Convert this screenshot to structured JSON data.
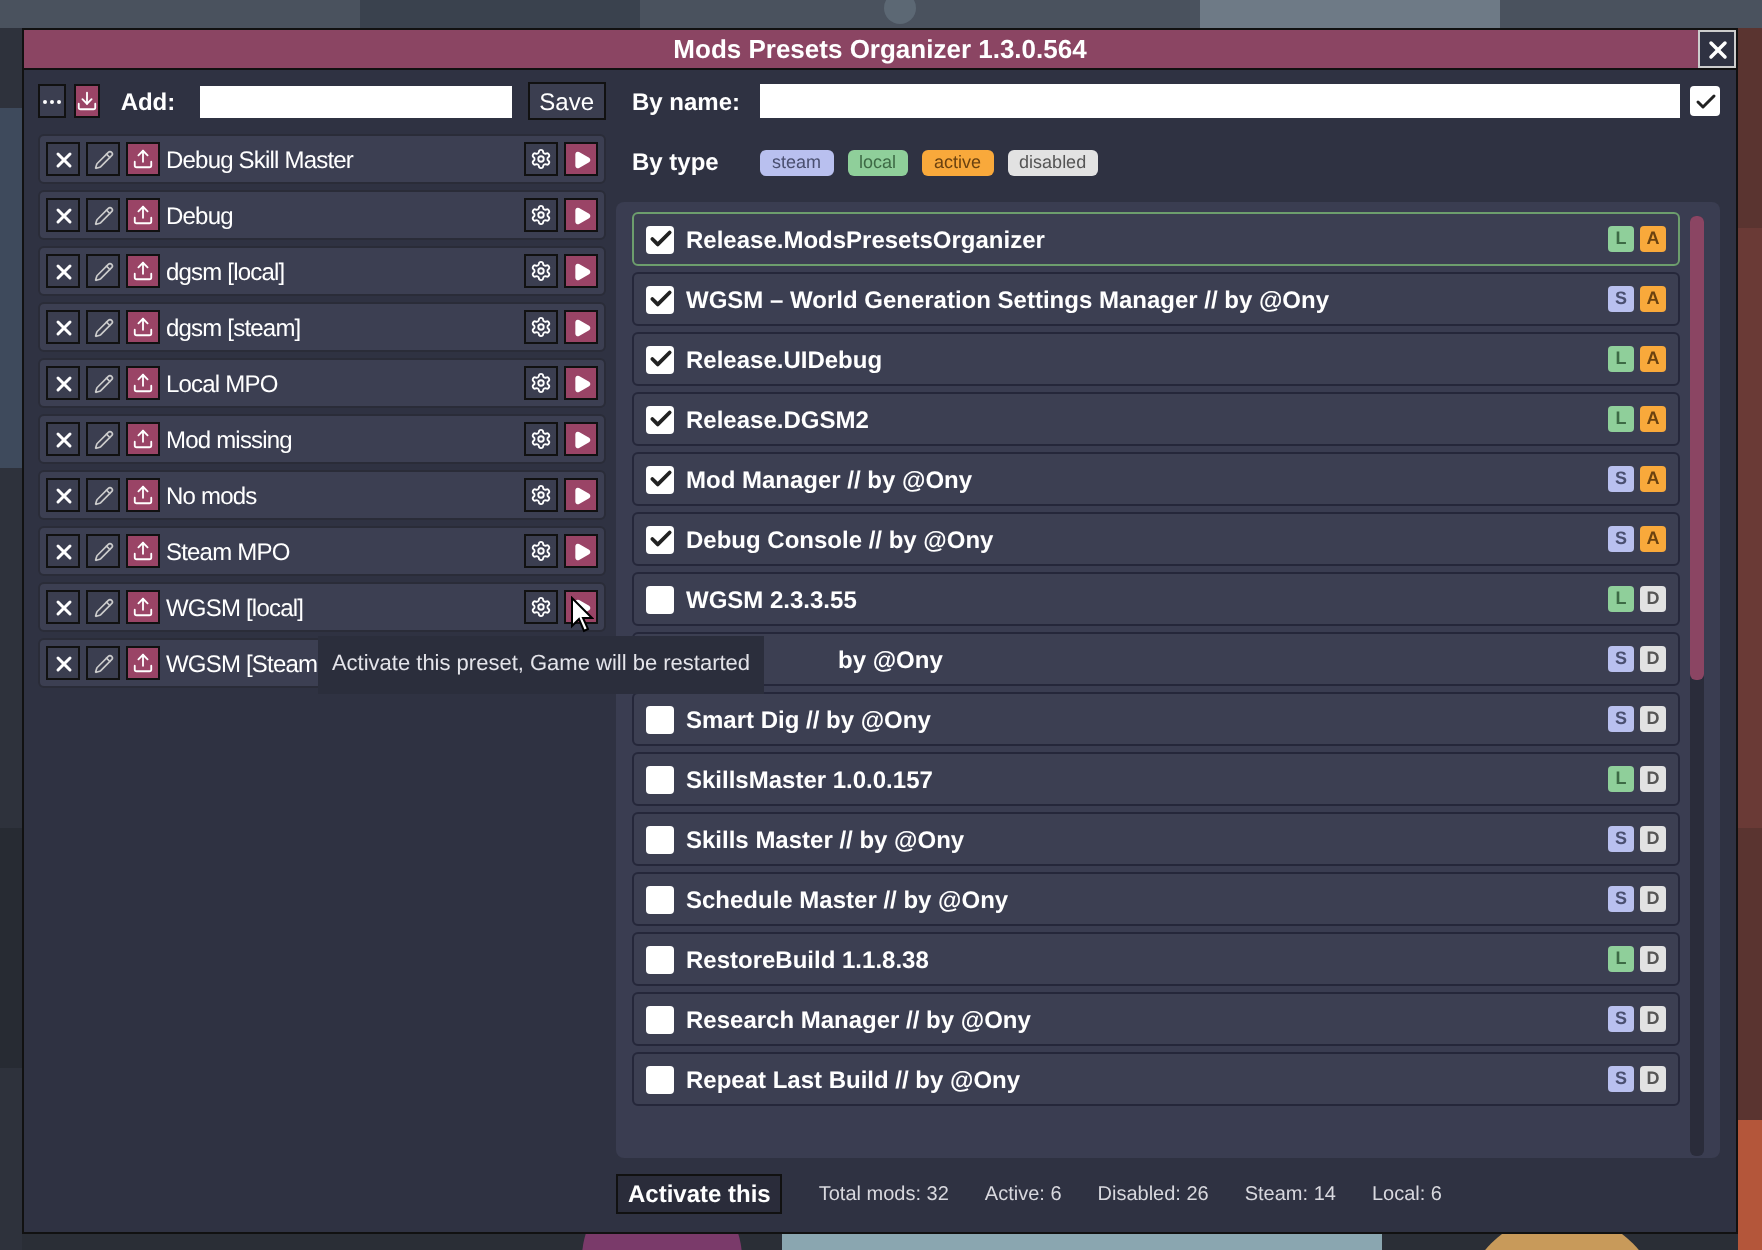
{
  "window": {
    "title": "Mods Presets Organizer 1.3.0.564"
  },
  "presets_toolbar": {
    "add_label": "Add:",
    "save_button": "Save"
  },
  "presets": [
    {
      "name": "Debug Skill Master",
      "covered": false
    },
    {
      "name": "Debug",
      "covered": false
    },
    {
      "name": "dgsm [local]",
      "covered": false
    },
    {
      "name": "dgsm [steam]",
      "covered": false
    },
    {
      "name": "Local MPO",
      "covered": false
    },
    {
      "name": "Mod missing",
      "covered": false
    },
    {
      "name": "No mods",
      "covered": false
    },
    {
      "name": "Steam MPO",
      "covered": false
    },
    {
      "name": "WGSM [local]",
      "covered": false
    },
    {
      "name": "WGSM [Steam",
      "covered": true
    }
  ],
  "tooltip": {
    "text": "Activate this preset, Game will be restarted"
  },
  "filters": {
    "by_name_label": "By name:",
    "by_name_checked": true,
    "by_type_label": "By type",
    "types": [
      {
        "label": "steam",
        "kind": "steam"
      },
      {
        "label": "local",
        "kind": "local"
      },
      {
        "label": "active",
        "kind": "active"
      },
      {
        "label": "disabled",
        "kind": "disabled"
      }
    ]
  },
  "mods": [
    {
      "name": "Release.ModsPresetsOrganizer",
      "checked": true,
      "selected": true,
      "covered": false,
      "badges": [
        {
          "text": "L",
          "kind": "local"
        },
        {
          "text": "A",
          "kind": "active"
        }
      ]
    },
    {
      "name": "WGSM – World Generation Settings Manager // by @Ony",
      "checked": true,
      "selected": false,
      "covered": false,
      "badges": [
        {
          "text": "S",
          "kind": "steam"
        },
        {
          "text": "A",
          "kind": "active"
        }
      ]
    },
    {
      "name": "Release.UIDebug",
      "checked": true,
      "selected": false,
      "covered": false,
      "badges": [
        {
          "text": "L",
          "kind": "local"
        },
        {
          "text": "A",
          "kind": "active"
        }
      ]
    },
    {
      "name": "Release.DGSM2",
      "checked": true,
      "selected": false,
      "covered": false,
      "badges": [
        {
          "text": "L",
          "kind": "local"
        },
        {
          "text": "A",
          "kind": "active"
        }
      ]
    },
    {
      "name": "Mod Manager // by @Ony",
      "checked": true,
      "selected": false,
      "covered": false,
      "badges": [
        {
          "text": "S",
          "kind": "steam"
        },
        {
          "text": "A",
          "kind": "active"
        }
      ]
    },
    {
      "name": "Debug Console // by @Ony",
      "checked": true,
      "selected": false,
      "covered": false,
      "badges": [
        {
          "text": "S",
          "kind": "steam"
        },
        {
          "text": "A",
          "kind": "active"
        }
      ]
    },
    {
      "name": "WGSM 2.3.3.55",
      "checked": false,
      "selected": false,
      "covered": false,
      "badges": [
        {
          "text": "L",
          "kind": "local"
        },
        {
          "text": "D",
          "kind": "disabled"
        }
      ]
    },
    {
      "name": "by @Ony",
      "selected": false,
      "covered": true,
      "badges": [
        {
          "text": "S",
          "kind": "steam"
        },
        {
          "text": "D",
          "kind": "disabled"
        }
      ]
    },
    {
      "name": "Smart Dig // by @Ony",
      "checked": false,
      "selected": false,
      "covered": false,
      "badges": [
        {
          "text": "S",
          "kind": "steam"
        },
        {
          "text": "D",
          "kind": "disabled"
        }
      ]
    },
    {
      "name": "SkillsMaster 1.0.0.157",
      "checked": false,
      "selected": false,
      "covered": false,
      "badges": [
        {
          "text": "L",
          "kind": "local"
        },
        {
          "text": "D",
          "kind": "disabled"
        }
      ]
    },
    {
      "name": "Skills Master // by @Ony",
      "checked": false,
      "selected": false,
      "covered": false,
      "badges": [
        {
          "text": "S",
          "kind": "steam"
        },
        {
          "text": "D",
          "kind": "disabled"
        }
      ]
    },
    {
      "name": "Schedule Master // by @Ony",
      "checked": false,
      "selected": false,
      "covered": false,
      "badges": [
        {
          "text": "S",
          "kind": "steam"
        },
        {
          "text": "D",
          "kind": "disabled"
        }
      ]
    },
    {
      "name": "RestoreBuild 1.1.8.38",
      "checked": false,
      "selected": false,
      "covered": false,
      "badges": [
        {
          "text": "L",
          "kind": "local"
        },
        {
          "text": "D",
          "kind": "disabled"
        }
      ]
    },
    {
      "name": "Research Manager // by @Ony",
      "checked": false,
      "selected": false,
      "covered": false,
      "badges": [
        {
          "text": "S",
          "kind": "steam"
        },
        {
          "text": "D",
          "kind": "disabled"
        }
      ]
    },
    {
      "name": "Repeat Last Build // by @Ony",
      "checked": false,
      "selected": false,
      "covered": false,
      "badges": [
        {
          "text": "S",
          "kind": "steam"
        },
        {
          "text": "D",
          "kind": "disabled"
        }
      ]
    }
  ],
  "footer": {
    "activate_button": "Activate this",
    "stats": [
      "Total mods: 32",
      "Active: 6",
      "Disabled: 26",
      "Steam: 14",
      "Local: 6"
    ]
  }
}
